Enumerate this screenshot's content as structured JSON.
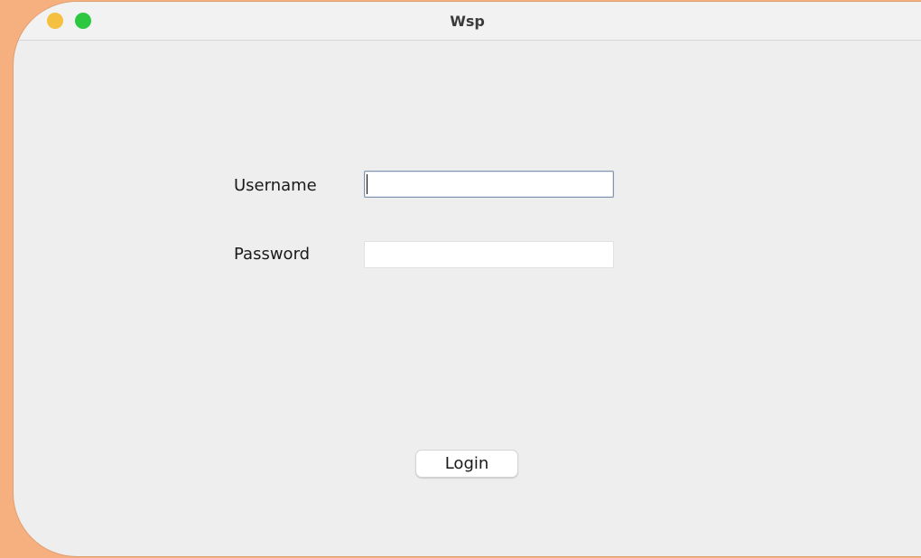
{
  "window": {
    "title": "Wsp"
  },
  "form": {
    "username_label": "Username",
    "username_value": "",
    "password_label": "Password",
    "password_value": "",
    "login_label": "Login"
  },
  "colors": {
    "background": "#f6b07f",
    "window": "#eeeeee",
    "minimize": "#f5bf3f",
    "zoom": "#2dc840"
  }
}
